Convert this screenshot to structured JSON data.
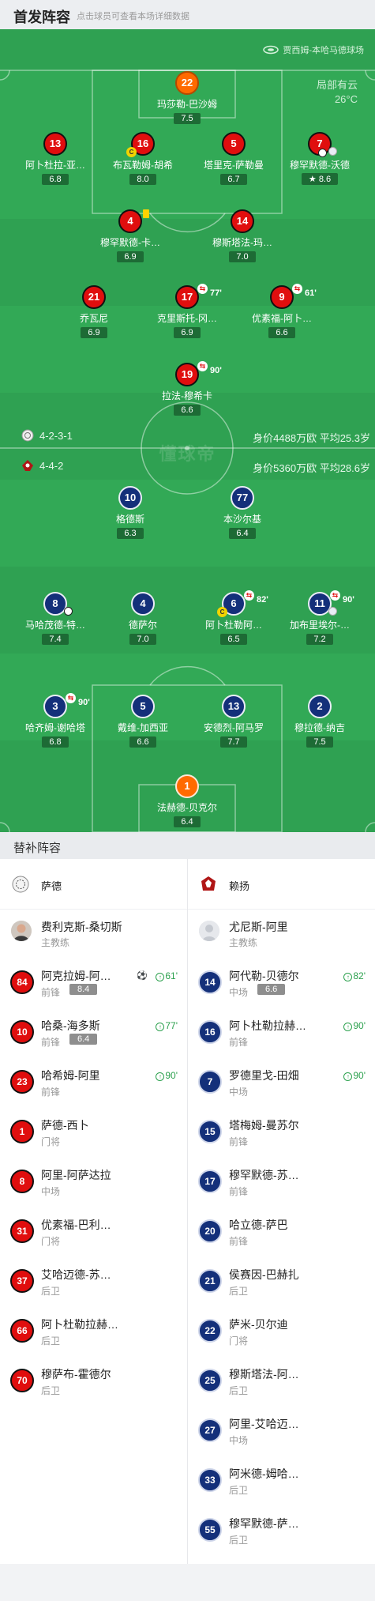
{
  "header": {
    "title": "首发阵容",
    "hint": "点击球员可查看本场详细数据"
  },
  "pitch": {
    "venue": "贾西姆-本哈马德球场",
    "weather": "局部有云",
    "temperature": "26°C",
    "watermark": "懂球帝"
  },
  "home_team": {
    "formation": "4-2-3-1",
    "value": "身价4488万欧 平均25.3岁"
  },
  "away_team": {
    "formation": "4-4-2",
    "value": "身价5360万欧 平均28.6岁"
  },
  "home_players": [
    {
      "number": "22",
      "name": "玛莎勒-巴沙姆",
      "rating": "7.5"
    },
    {
      "number": "13",
      "name": "阿卜杜拉-亚…",
      "rating": "6.8"
    },
    {
      "number": "16",
      "name": "布瓦勒姆-胡希",
      "rating": "8.0"
    },
    {
      "number": "5",
      "name": "塔里克-萨勒曼",
      "rating": "6.7"
    },
    {
      "number": "7",
      "name": "穆罕默德-沃德",
      "rating": "8.6"
    },
    {
      "number": "4",
      "name": "穆罕默德-卡…",
      "rating": "6.9"
    },
    {
      "number": "14",
      "name": "穆斯塔法-玛…",
      "rating": "7.0"
    },
    {
      "number": "21",
      "name": "乔瓦尼",
      "rating": "6.9"
    },
    {
      "number": "17",
      "name": "克里斯托-冈…",
      "rating": "6.9",
      "sub_min": "77'"
    },
    {
      "number": "9",
      "name": "优素福-阿卜…",
      "rating": "6.6",
      "sub_min": "61'"
    },
    {
      "number": "19",
      "name": "拉法-穆希卡",
      "rating": "6.6",
      "sub_min": "90'"
    }
  ],
  "away_players": [
    {
      "number": "10",
      "name": "格德斯",
      "rating": "6.3"
    },
    {
      "number": "77",
      "name": "本沙尔基",
      "rating": "6.4"
    },
    {
      "number": "8",
      "name": "马哈茂德-特…",
      "rating": "7.4"
    },
    {
      "number": "4",
      "name": "德萨尔",
      "rating": "7.0"
    },
    {
      "number": "6",
      "name": "阿卜杜勒阿…",
      "rating": "6.5",
      "sub_min": "82'"
    },
    {
      "number": "11",
      "name": "加布里埃尔-…",
      "rating": "7.2",
      "sub_min": "90'"
    },
    {
      "number": "3",
      "name": "哈齐姆-谢哈塔",
      "rating": "6.8",
      "sub_min": "90'"
    },
    {
      "number": "5",
      "name": "戴维-加西亚",
      "rating": "6.6"
    },
    {
      "number": "13",
      "name": "安德烈-阿马罗",
      "rating": "7.7"
    },
    {
      "number": "2",
      "name": "穆拉德-纳吉",
      "rating": "7.5"
    },
    {
      "number": "1",
      "name": "法赫德-贝克尔",
      "rating": "6.4"
    }
  ],
  "subs": {
    "title": "替补阵容",
    "home": {
      "team_name": "萨德",
      "coach": {
        "name": "费利克斯-桑切斯",
        "role": "主教练"
      },
      "players": [
        {
          "number": "84",
          "name": "阿克拉姆-阿…",
          "pos": "前锋",
          "rating": "8.4",
          "in": "61'"
        },
        {
          "number": "10",
          "name": "哈桑-海多斯",
          "pos": "前锋",
          "rating": "6.4",
          "in": "77'"
        },
        {
          "number": "23",
          "name": "哈希姆-阿里",
          "pos": "前锋",
          "in": "90'"
        },
        {
          "number": "1",
          "name": "萨德-西卜",
          "pos": "门将"
        },
        {
          "number": "8",
          "name": "阿里-阿萨达拉",
          "pos": "中场"
        },
        {
          "number": "31",
          "name": "优素福-巴利…",
          "pos": "门将"
        },
        {
          "number": "37",
          "name": "艾哈迈德-苏…",
          "pos": "后卫"
        },
        {
          "number": "66",
          "name": "阿卜杜勒拉赫…",
          "pos": "后卫"
        },
        {
          "number": "70",
          "name": "穆萨布-霍德尔",
          "pos": "后卫"
        }
      ]
    },
    "away": {
      "team_name": "赖扬",
      "coach": {
        "name": "尤尼斯-阿里",
        "role": "主教练"
      },
      "players": [
        {
          "number": "14",
          "name": "阿代勒-贝德尔",
          "pos": "中场",
          "rating": "6.6",
          "in": "82'"
        },
        {
          "number": "16",
          "name": "阿卜杜勒拉赫…",
          "pos": "前锋",
          "in": "90'"
        },
        {
          "number": "7",
          "name": "罗德里戈-田畑",
          "pos": "中场",
          "in": "90'"
        },
        {
          "number": "15",
          "name": "塔梅姆-曼苏尔",
          "pos": "前锋"
        },
        {
          "number": "17",
          "name": "穆罕默德-苏…",
          "pos": "前锋"
        },
        {
          "number": "20",
          "name": "哈立德-萨巴",
          "pos": "前锋"
        },
        {
          "number": "21",
          "name": "侯赛因-巴赫扎",
          "pos": "后卫"
        },
        {
          "number": "22",
          "name": "萨米-贝尔迪",
          "pos": "门将"
        },
        {
          "number": "25",
          "name": "穆斯塔法-阿…",
          "pos": "后卫"
        },
        {
          "number": "27",
          "name": "阿里-艾哈迈…",
          "pos": "中场"
        },
        {
          "number": "33",
          "name": "阿米德-姆哈…",
          "pos": "后卫"
        },
        {
          "number": "55",
          "name": "穆罕默德-萨…",
          "pos": "后卫"
        }
      ]
    }
  },
  "icons": {
    "captain": "C",
    "sub_marker": "⇆",
    "sub_in": "↑"
  }
}
